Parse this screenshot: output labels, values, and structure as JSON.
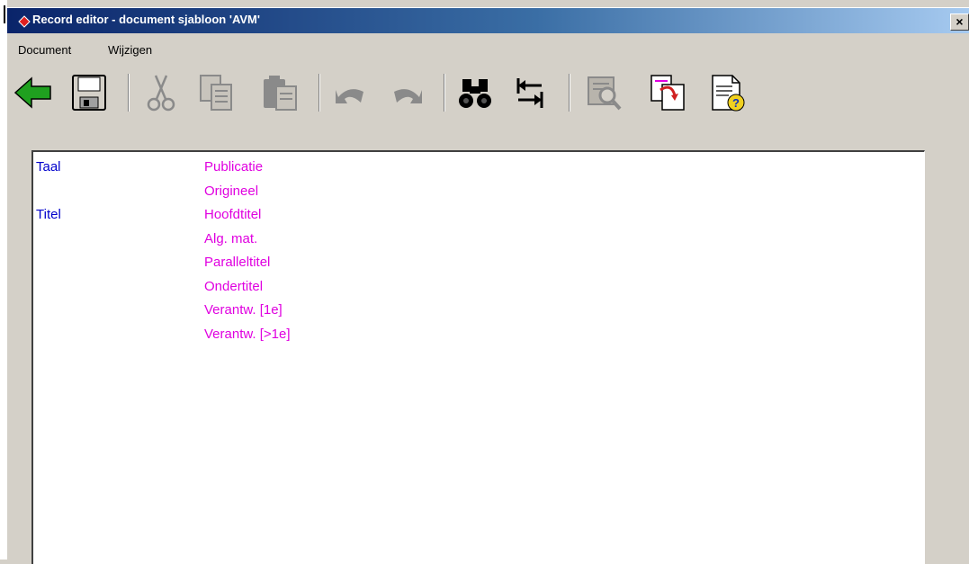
{
  "window": {
    "title": "Record editor - document sjabloon 'AVM'",
    "close_label": "×"
  },
  "menu": {
    "items": [
      {
        "label": "Document"
      },
      {
        "label": "Wijzigen"
      }
    ]
  },
  "toolbar": {
    "buttons": [
      {
        "icon": "back-arrow-icon",
        "enabled": true
      },
      {
        "icon": "save-icon",
        "enabled": true
      },
      {
        "icon": "cut-icon",
        "enabled": false
      },
      {
        "icon": "copy-icon",
        "enabled": false
      },
      {
        "icon": "paste-icon",
        "enabled": false
      },
      {
        "icon": "undo-icon",
        "enabled": false
      },
      {
        "icon": "redo-icon",
        "enabled": false
      },
      {
        "icon": "find-icon",
        "enabled": true
      },
      {
        "icon": "swap-icon",
        "enabled": true
      },
      {
        "icon": "book-search-icon",
        "enabled": false
      },
      {
        "icon": "insert-page-icon",
        "enabled": true
      },
      {
        "icon": "help-document-icon",
        "enabled": true
      }
    ]
  },
  "editor": {
    "rows": [
      {
        "label": "Taal",
        "value": "Publicatie"
      },
      {
        "label": "",
        "value": "Origineel"
      },
      {
        "label": "Titel",
        "value": "Hoofdtitel"
      },
      {
        "label": "",
        "value": "Alg. mat."
      },
      {
        "label": "",
        "value": "Paralleltitel"
      },
      {
        "label": "",
        "value": "Ondertitel"
      },
      {
        "label": "",
        "value": "Verantw. [1e]"
      },
      {
        "label": "",
        "value": "Verantw. [>1e]"
      }
    ]
  },
  "colors": {
    "label": "#0000cc",
    "value": "#e000e0",
    "titlebar_start": "#0a246a",
    "titlebar_end": "#a6caf0"
  }
}
